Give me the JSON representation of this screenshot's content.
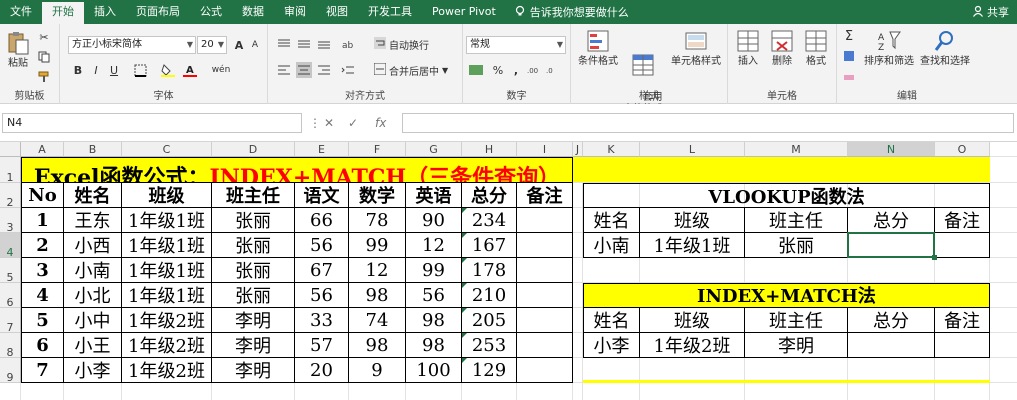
{
  "ribbon_tabs": [
    "文件",
    "开始",
    "插入",
    "页面布局",
    "公式",
    "数据",
    "审阅",
    "视图",
    "开发工具",
    "Power Pivot"
  ],
  "tell_me": "告诉我你想要做什么",
  "share": "共享",
  "clipboard": {
    "paste": "粘贴",
    "label": "剪贴板"
  },
  "font": {
    "name": "方正小标宋简体",
    "size": "20",
    "bold": "B",
    "italic": "I",
    "underline": "U",
    "grow": "A",
    "shrink": "A",
    "wen": "wén",
    "label": "字体"
  },
  "alignment": {
    "wrap": "自动换行",
    "merge": "合并后居中",
    "label": "对齐方式"
  },
  "number": {
    "format": "常规",
    "percent": "%",
    "comma": ",",
    "label": "数字"
  },
  "styles": {
    "cond": "条件格式",
    "table": "套用\n表格格式",
    "cell": "单元格样式",
    "label": "样式"
  },
  "cells": {
    "insert": "插入",
    "delete": "删除",
    "format": "格式",
    "label": "单元格"
  },
  "editing": {
    "sort": "排序和筛选",
    "find": "查找和选择",
    "label": "编辑"
  },
  "formula_bar": {
    "name_box": "N4",
    "fx": "fx",
    "content": ""
  },
  "columns": [
    "A",
    "B",
    "C",
    "D",
    "E",
    "F",
    "G",
    "H",
    "I",
    "J",
    "K",
    "L",
    "M",
    "N",
    "O"
  ],
  "rows": [
    "1",
    "2",
    "3",
    "4",
    "5",
    "6",
    "7",
    "8",
    "9"
  ],
  "title": {
    "part1": "Excel函数公式：",
    "part2": "INDEX+MATCH（三条件查询）"
  },
  "headers": [
    "No",
    "姓名",
    "班级",
    "班主任",
    "语文",
    "数学",
    "英语",
    "总分",
    "备注"
  ],
  "data_rows": [
    [
      "1",
      "王东",
      "1年级1班",
      "张丽",
      "66",
      "78",
      "90",
      "234",
      ""
    ],
    [
      "2",
      "小西",
      "1年级1班",
      "张丽",
      "56",
      "99",
      "12",
      "167",
      ""
    ],
    [
      "3",
      "小南",
      "1年级1班",
      "张丽",
      "67",
      "12",
      "99",
      "178",
      ""
    ],
    [
      "4",
      "小北",
      "1年级1班",
      "张丽",
      "56",
      "98",
      "56",
      "210",
      ""
    ],
    [
      "5",
      "小中",
      "1年级2班",
      "李明",
      "33",
      "74",
      "98",
      "205",
      ""
    ],
    [
      "6",
      "小王",
      "1年级2班",
      "李明",
      "57",
      "98",
      "98",
      "253",
      ""
    ],
    [
      "7",
      "小李",
      "1年级2班",
      "李明",
      "20",
      "9",
      "100",
      "129",
      ""
    ]
  ],
  "vlookup": {
    "title": "VLOOKUP函数法",
    "headers": [
      "姓名",
      "班级",
      "班主任",
      "总分",
      "备注"
    ],
    "row": [
      "小南",
      "1年级1班",
      "张丽",
      "",
      ""
    ]
  },
  "indexmatch": {
    "title": "INDEX+MATCH法",
    "headers": [
      "姓名",
      "班级",
      "班主任",
      "总分",
      "备注"
    ],
    "row": [
      "小李",
      "1年级2班",
      "李明",
      "",
      ""
    ]
  },
  "colors": {
    "excel_green": "#217346",
    "highlight": "#ffff00",
    "title_red": "#ff0000"
  }
}
